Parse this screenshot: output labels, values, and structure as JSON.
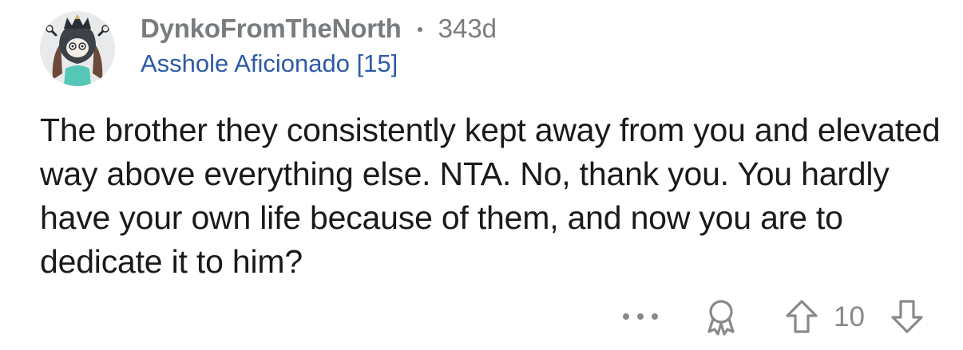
{
  "comment": {
    "author": "DynkoFromTheNorth",
    "age": "343d",
    "flair": "Asshole Aficionado [15]",
    "body": "The brother they consistently kept away from you and elevated way above everything else. NTA. No, thank you. You hardly have your own life because of them, and now you are to dedicate it to him?",
    "score": "10"
  },
  "icons": {
    "avatar": "user-avatar",
    "more": "more-icon",
    "award": "award-icon",
    "upvote": "upvote-arrow-icon",
    "downvote": "downvote-arrow-icon"
  },
  "colors": {
    "username": "#787c7e",
    "flair": "#2e5aa8",
    "body": "#1a1a1b",
    "icon": "#878a8c"
  }
}
